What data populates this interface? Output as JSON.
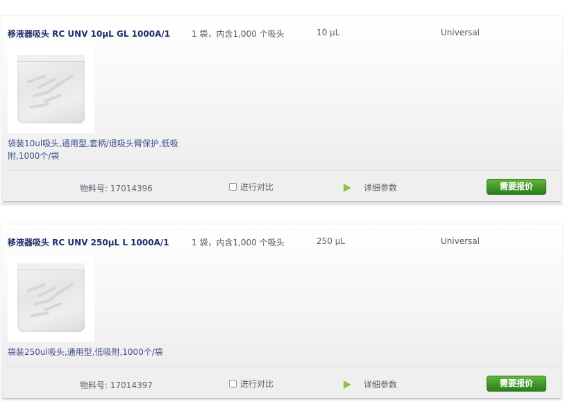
{
  "products": [
    {
      "title": "移液器吸头 RC UNV 10µL GL 1000A/1",
      "pack": "1 袋，内含1,000 个吸头",
      "volume": "10 µL",
      "type": "Universal",
      "description": "袋装10ul吸头,通用型,套柄/退吸头臂保护,低吸附,1000个/袋",
      "sku": "物料号: 17014396",
      "compare_label": "进行对比",
      "details_label": "详细参数",
      "quote_label": "需要报价"
    },
    {
      "title": "移液器吸头 RC UNV 250µL L 1000A/1",
      "pack": "1 袋，内含1,000 个吸头",
      "volume": "250 µL",
      "type": "Universal",
      "description": "袋装250ul吸头,通用型,低吸附,1000个/袋",
      "sku": "物料号: 17014397",
      "compare_label": "进行对比",
      "details_label": "详细参数",
      "quote_label": "需要报价"
    }
  ],
  "icons": {
    "details": "play-triangle-icon",
    "compare": "checkbox-icon"
  },
  "colors": {
    "title": "#1d2e6b",
    "description": "#3d4f8e",
    "quote_button": "#3f9628",
    "details_arrow": "#8cc43d"
  }
}
